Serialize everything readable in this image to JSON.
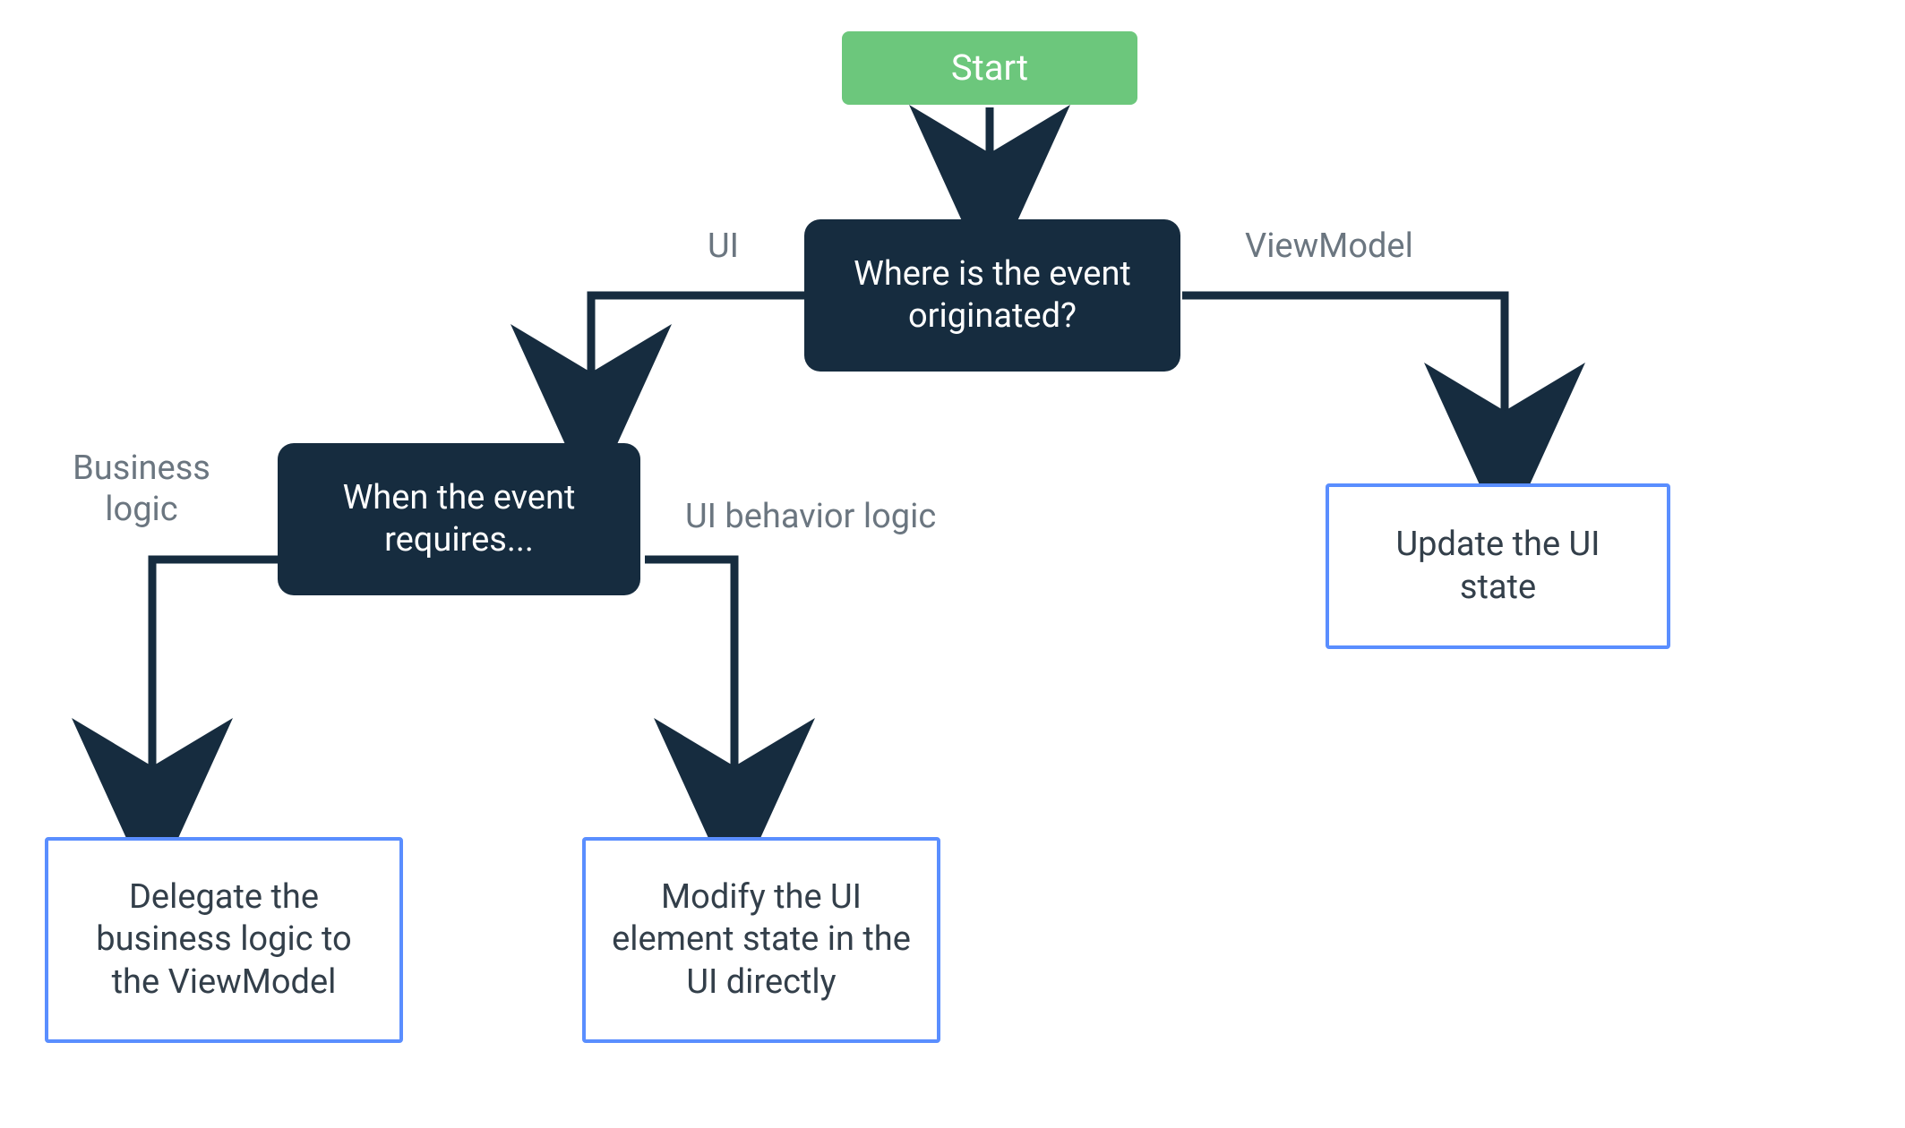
{
  "nodes": {
    "start": "Start",
    "origin": "Where is the event originated?",
    "requires": "When the event requires...",
    "update_state": "Update the UI state",
    "delegate": "Delegate the business logic to the ViewModel",
    "modify_ui": "Modify the UI element state in the UI directly"
  },
  "edges": {
    "ui": "UI",
    "viewmodel": "ViewModel",
    "business_logic": "Business logic",
    "ui_behavior_logic": "UI behavior logic"
  },
  "colors": {
    "start_bg": "#6cc77c",
    "decision_bg": "#162c3f",
    "terminal_border": "#5a8eff",
    "edge_label": "#6b7680",
    "arrow": "#162c3f"
  }
}
